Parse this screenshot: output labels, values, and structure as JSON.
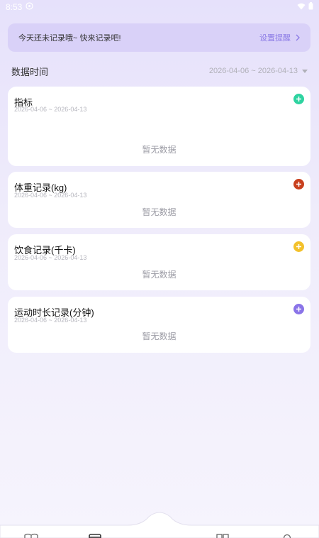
{
  "status_bar": {
    "time": "8:53"
  },
  "banner": {
    "text": "今天还未记录哦~ 快来记录吧!",
    "link_label": "设置提醒"
  },
  "range": {
    "label": "数据时间",
    "value": "2026-04-06 ~ 2026-04-13"
  },
  "cards": [
    {
      "title": "指标",
      "date": "2026-04-06 ~ 2026-04-13",
      "empty": "暂无数据",
      "accent": "#2ed3a0"
    },
    {
      "title": "体重记录(kg)",
      "date": "2026-04-06 ~ 2026-04-13",
      "empty": "暂无数据",
      "accent": "#c8401e"
    },
    {
      "title": "饮食记录(千卡)",
      "date": "2026-04-06 ~ 2026-04-13",
      "empty": "暂无数据",
      "accent": "#f3c12b"
    },
    {
      "title": "运动时长记录(分钟)",
      "date": "2026-04-06 ~ 2026-04-13",
      "empty": "暂无数据",
      "accent": "#8a74e8"
    }
  ]
}
